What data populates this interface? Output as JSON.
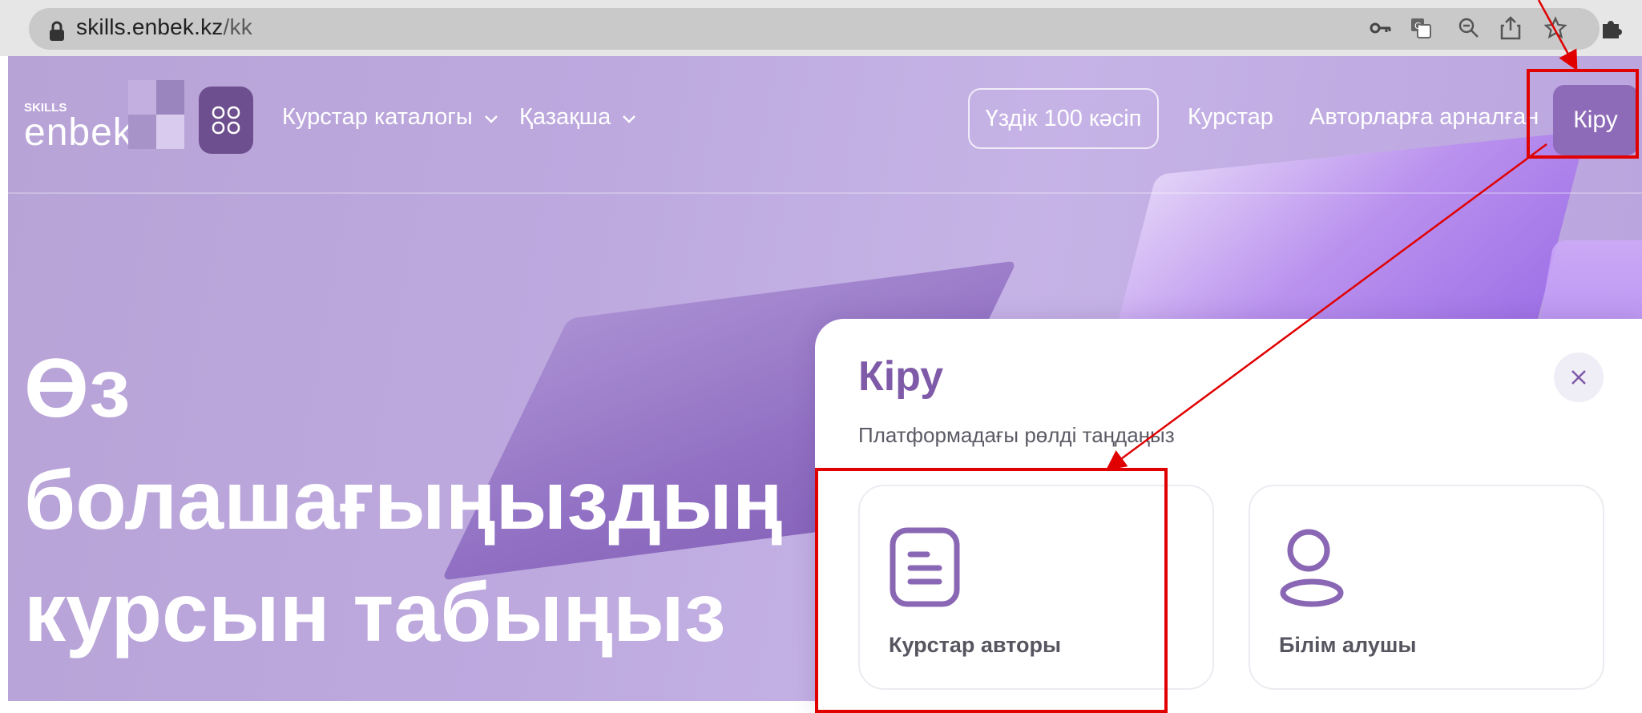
{
  "browser": {
    "url_host": "skills.enbek.kz",
    "url_path": "/kk",
    "icons": [
      "lock-icon",
      "key-icon",
      "translate-icon",
      "zoom-out-icon",
      "share-icon",
      "star-icon",
      "extensions-icon"
    ]
  },
  "header": {
    "logo_small": "SKILLS",
    "logo_main": "enbek",
    "nav": {
      "catalog": "Курстар каталогы",
      "language": "Қазақша",
      "top100": "Үздік 100 кәсіп",
      "courses": "Курстар",
      "for_authors": "Авторларға арналған",
      "login": "Кіру"
    }
  },
  "hero": {
    "title_lines": [
      "Өз",
      "болашағыңыздың",
      "курсын табыңыз"
    ]
  },
  "modal": {
    "title": "Кіру",
    "subtitle": "Платформадағы рөлді таңдаңыз",
    "roles": [
      {
        "label": "Курстар авторы",
        "icon": "document-icon"
      },
      {
        "label": "Білім алушы",
        "icon": "user-icon"
      }
    ]
  },
  "colors": {
    "accent": "#7e5aa8",
    "hero_bg": "#bca8dd",
    "annotation": "#e00000"
  }
}
